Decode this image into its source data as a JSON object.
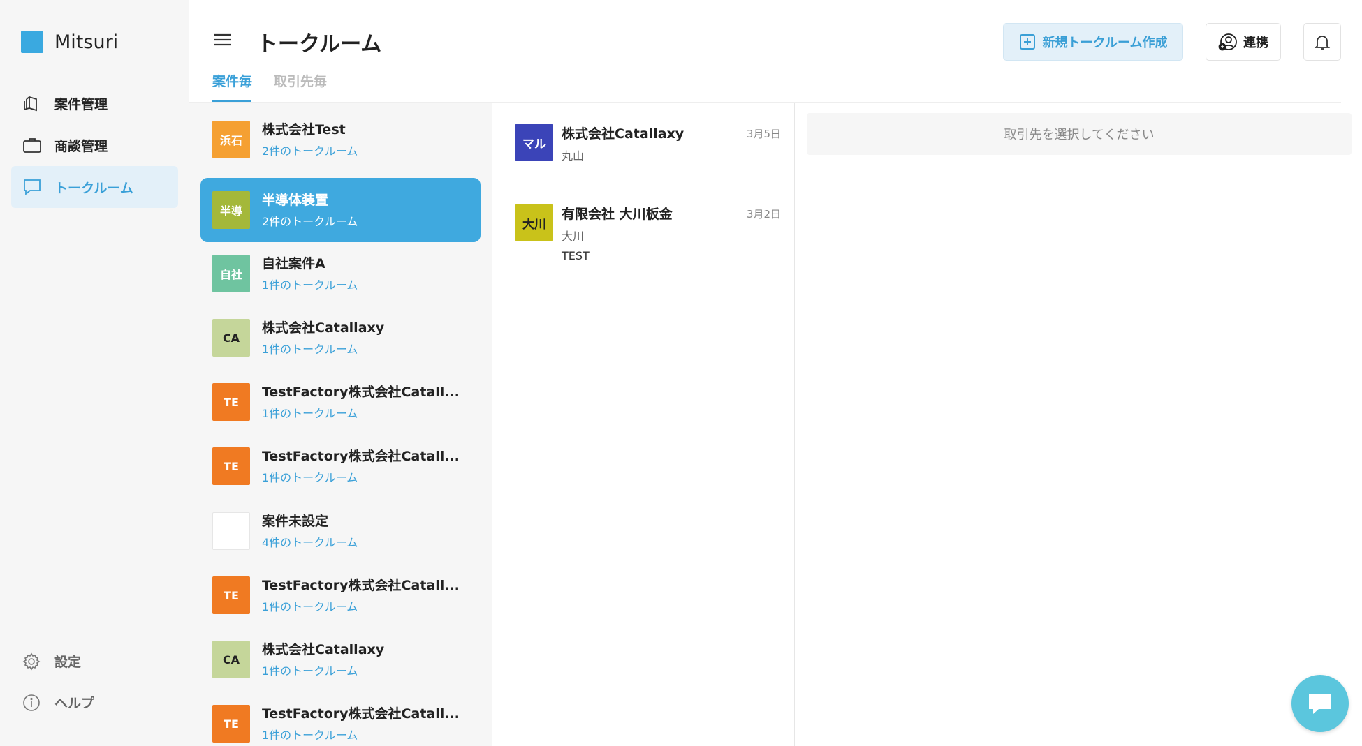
{
  "app": {
    "name": "Mitsuri",
    "brand_color": "#3aa9e0"
  },
  "sidebar": {
    "items": [
      {
        "label": "案件管理",
        "icon": "cube-stack-icon"
      },
      {
        "label": "商談管理",
        "icon": "briefcase-icon"
      },
      {
        "label": "トークルーム",
        "icon": "chat-bubble-icon",
        "active": true
      }
    ],
    "footer": [
      {
        "label": "設定",
        "icon": "gear-icon"
      },
      {
        "label": "ヘルプ",
        "icon": "info-icon"
      }
    ]
  },
  "header": {
    "title": "トークルーム",
    "new_room_label": "新規トークルーム作成",
    "link_label": "連携"
  },
  "tabs": [
    {
      "label": "案件毎",
      "active": true
    },
    {
      "label": "取引先毎",
      "active": false
    }
  ],
  "projects": [
    {
      "avatar": "浜石",
      "color": "#f5a032",
      "name": "株式会社Test",
      "count": "2件のトークルーム"
    },
    {
      "avatar": "半導",
      "color": "#a4b83a",
      "name": "半導体装置",
      "count": "2件のトークルーム",
      "active": true
    },
    {
      "avatar": "自社",
      "color": "#6fc4a0",
      "name": "自社案件A",
      "count": "1件のトークルーム"
    },
    {
      "avatar": "CA",
      "color": "#c5d69a",
      "name": "株式会社Catallaxy",
      "count": "1件のトークルーム"
    },
    {
      "avatar": "TE",
      "color": "#f07a22",
      "name": "TestFactory株式会社Catall...",
      "count": "1件のトークルーム"
    },
    {
      "avatar": "TE",
      "color": "#f07a22",
      "name": "TestFactory株式会社Catall...",
      "count": "1件のトークルーム"
    },
    {
      "avatar": "",
      "color": "#ffffff",
      "name": "案件未設定",
      "count": "4件のトークルーム"
    },
    {
      "avatar": "TE",
      "color": "#f07a22",
      "name": "TestFactory株式会社Catall...",
      "count": "1件のトークルーム"
    },
    {
      "avatar": "CA",
      "color": "#c5d69a",
      "name": "株式会社Catallaxy",
      "count": "1件のトークルーム"
    },
    {
      "avatar": "TE",
      "color": "#f07a22",
      "name": "TestFactory株式会社Catall...",
      "count": "1件のトークルーム"
    }
  ],
  "clients": [
    {
      "avatar": "マル",
      "color": "#3b44b8",
      "text_color": "#ffffff",
      "name": "株式会社Catallaxy",
      "person": "丸山",
      "message": "",
      "date": "3月5日"
    },
    {
      "avatar": "大川",
      "color": "#c9c21a",
      "text_color": "#222222",
      "name": "有限会社 大川板金",
      "person": "大川",
      "message": "TEST",
      "date": "3月2日"
    }
  ],
  "detail": {
    "placeholder": "取引先を選択してください"
  }
}
